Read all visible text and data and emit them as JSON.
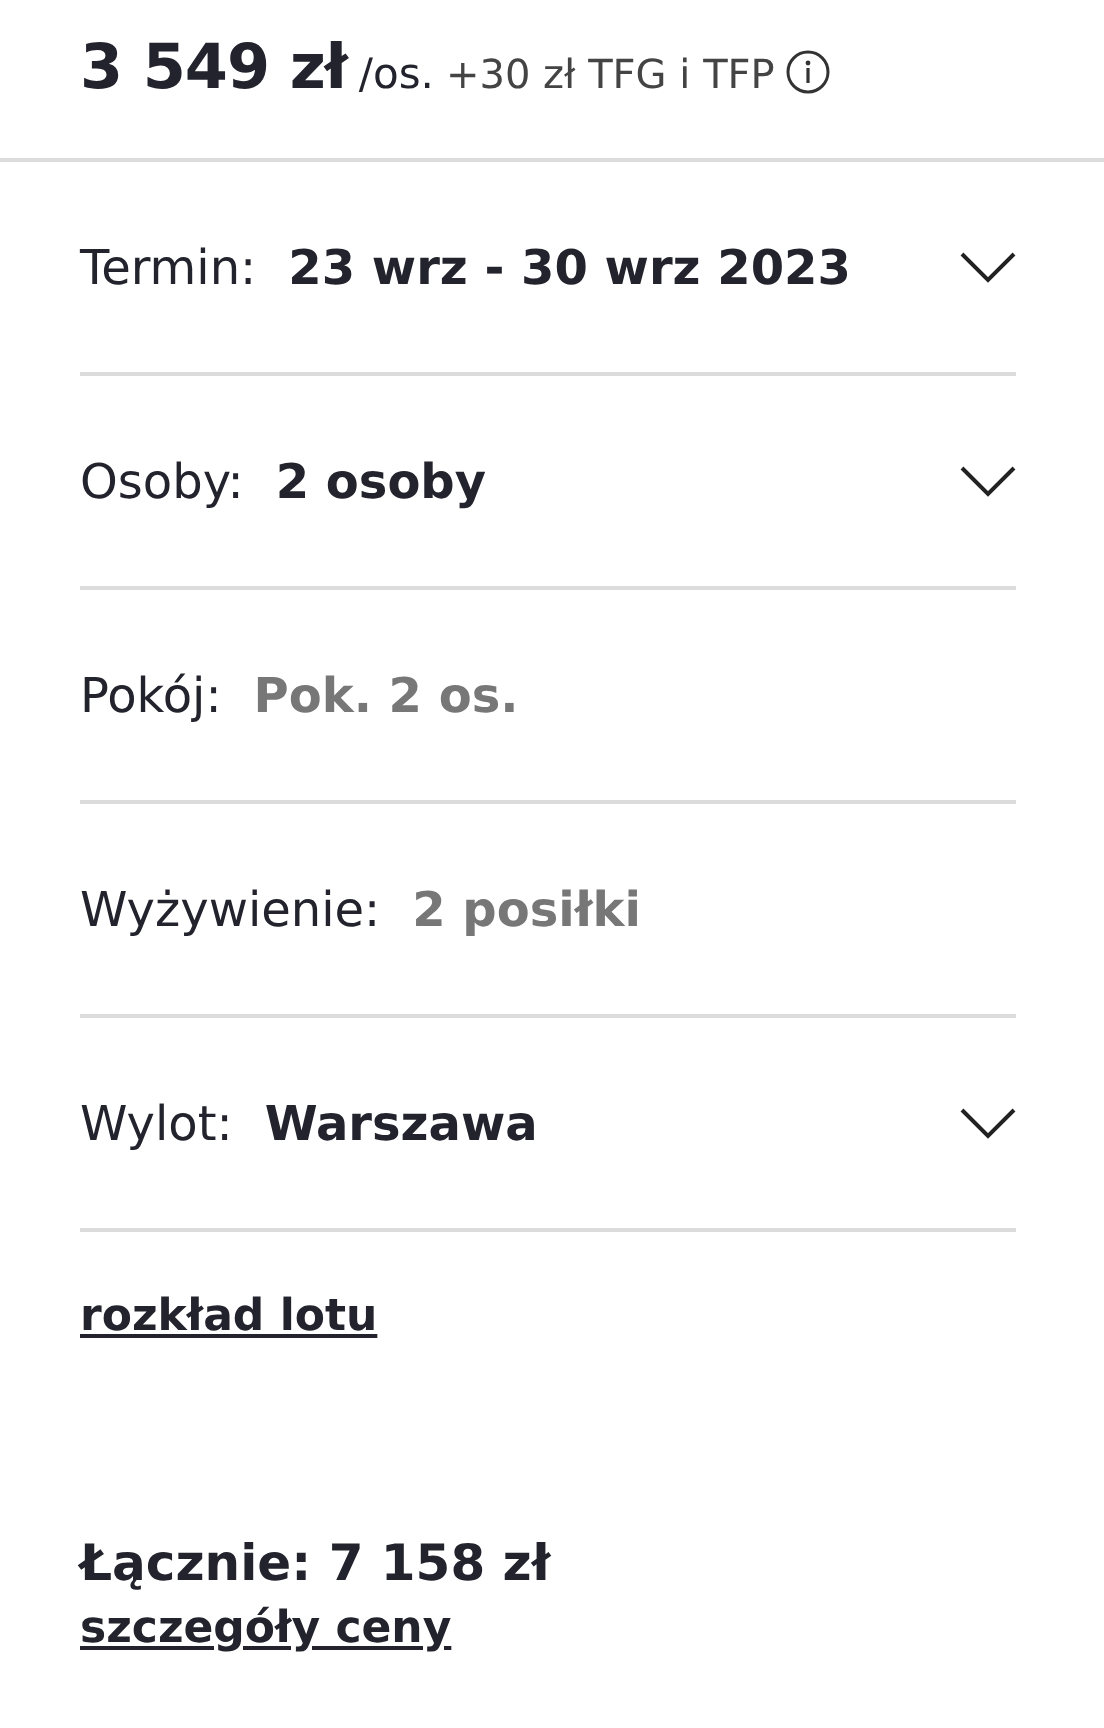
{
  "price": {
    "amount": "3 549 zł",
    "unit": "/os.",
    "extra": "+30 zł TFG i TFP"
  },
  "fields": [
    {
      "label": "Termin:",
      "value": "23 wrz - 30 wrz 2023",
      "kind": "dropdown"
    },
    {
      "label": "Osoby:",
      "value": "2 osoby",
      "kind": "dropdown"
    },
    {
      "label": "Pokój:",
      "value": "Pok. 2 os.",
      "kind": "fixed"
    },
    {
      "label": "Wyżywienie:",
      "value": "2 posiłki",
      "kind": "fixed"
    },
    {
      "label": "Wylot:",
      "value": "Warszawa",
      "kind": "dropdown"
    }
  ],
  "flight_link": "rozkład lotu",
  "total": "Łącznie: 7 158 zł",
  "details_link": "szczegóły ceny"
}
